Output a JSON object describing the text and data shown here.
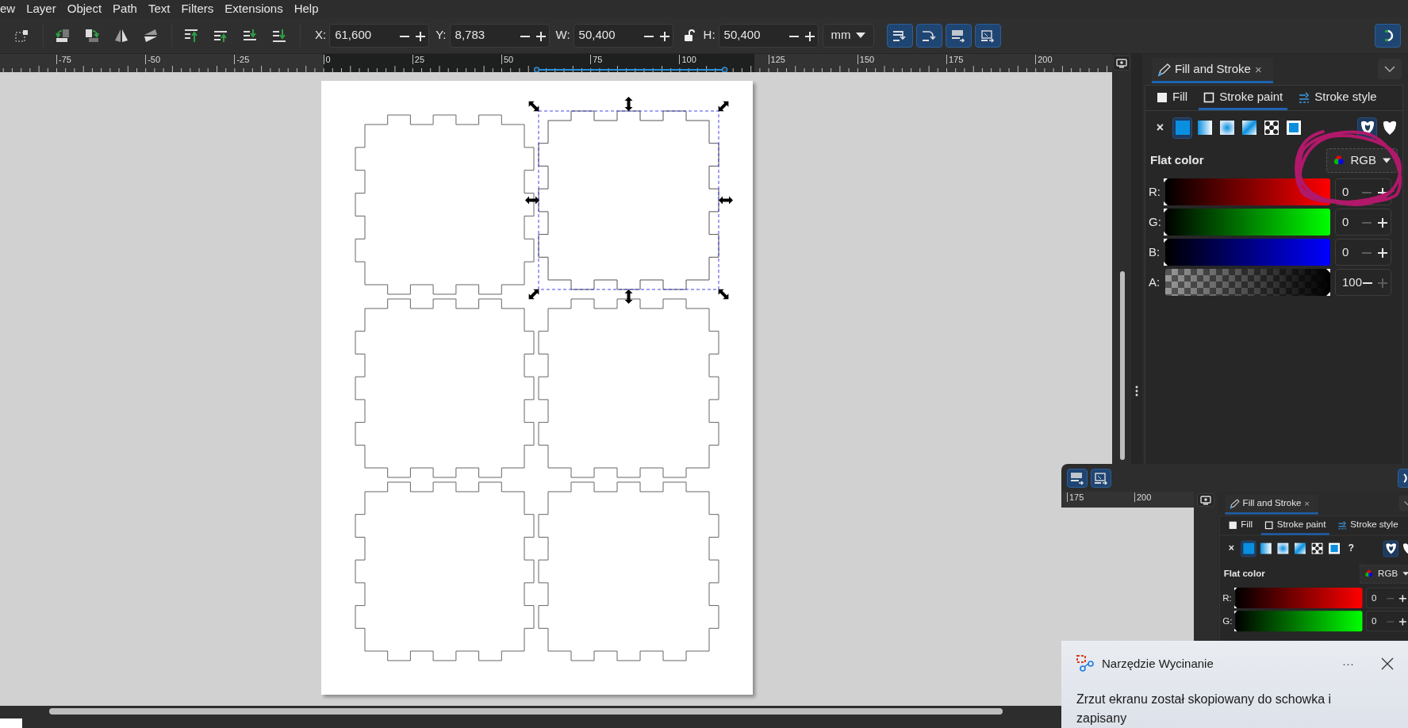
{
  "menu": [
    "ew",
    "Layer",
    "Object",
    "Path",
    "Text",
    "Filters",
    "Extensions",
    "Help"
  ],
  "toolbar": {
    "fields": [
      {
        "label": "X:",
        "value": "61,600"
      },
      {
        "label": "Y:",
        "value": "8,783"
      },
      {
        "label": "W:",
        "value": "50,400"
      },
      {
        "label": "H:",
        "value": "50,400"
      }
    ],
    "unit": "mm"
  },
  "ruler": [
    "-75",
    "-50",
    "-25",
    "0",
    "25",
    "50",
    "75",
    "100",
    "125",
    "150",
    "175",
    "200"
  ],
  "canvas": {
    "pieces": [
      {
        "selected": false
      },
      {
        "selected": true
      },
      {
        "selected": false
      },
      {
        "selected": false
      },
      {
        "selected": false
      },
      {
        "selected": false
      }
    ]
  },
  "panel": {
    "tab": "Fill and Stroke",
    "close": "×",
    "subtabs": [
      {
        "kind": "fill",
        "label": "Fill",
        "selected": false
      },
      {
        "kind": "stroke-paint",
        "label": "Stroke paint",
        "selected": true
      },
      {
        "kind": "stroke-style",
        "label": "Stroke style",
        "selected": false
      }
    ],
    "paint_types": [
      {
        "kind": "none",
        "label": "×",
        "selected": false
      },
      {
        "kind": "flat",
        "selected": true
      },
      {
        "kind": "linear",
        "selected": false
      },
      {
        "kind": "radial",
        "selected": false
      },
      {
        "kind": "mesh",
        "selected": false
      },
      {
        "kind": "pattern",
        "selected": false
      },
      {
        "kind": "swatch",
        "selected": false
      }
    ],
    "fill_rules": [
      {
        "kind": "evenodd",
        "selected": true
      },
      {
        "kind": "nonzero",
        "selected": false
      }
    ],
    "mode": "Flat color",
    "color_model": "RGB",
    "channels": [
      {
        "label": "R:",
        "kind": "red",
        "level": 0,
        "value": "0",
        "minus_disabled": true,
        "plus_disabled": false
      },
      {
        "label": "G:",
        "kind": "green",
        "level": 0,
        "value": "0",
        "minus_disabled": true,
        "plus_disabled": false
      },
      {
        "label": "B:",
        "kind": "blue",
        "level": 0,
        "value": "0",
        "minus_disabled": true,
        "plus_disabled": false
      },
      {
        "label": "A:",
        "kind": "alpha",
        "level": 1,
        "value": "100",
        "minus_disabled": false,
        "plus_disabled": true
      }
    ]
  },
  "second_window": {
    "ruler": [
      "175",
      "200"
    ],
    "panel": {
      "tab": "Fill and Stroke",
      "close": "×",
      "subtabs": [
        {
          "kind": "fill",
          "label": "Fill",
          "selected": false
        },
        {
          "kind": "stroke-paint",
          "label": "Stroke paint",
          "selected": true
        },
        {
          "kind": "stroke-style",
          "label": "Stroke style",
          "selected": false
        }
      ],
      "paint_types": [
        {
          "kind": "none",
          "label": "×",
          "selected": false
        },
        {
          "kind": "flat",
          "selected": true
        },
        {
          "kind": "linear",
          "selected": false
        },
        {
          "kind": "radial",
          "selected": false
        },
        {
          "kind": "mesh",
          "selected": false
        },
        {
          "kind": "pattern",
          "selected": false
        },
        {
          "kind": "swatch",
          "selected": false
        },
        {
          "kind": "unset",
          "label": "?",
          "selected": false
        }
      ],
      "fill_rules": [
        {
          "kind": "evenodd",
          "selected": true
        },
        {
          "kind": "nonzero",
          "selected": false
        }
      ],
      "mode": "Flat color",
      "color_model": "RGB",
      "channels": [
        {
          "label": "R:",
          "kind": "red",
          "level": 0,
          "value": "0",
          "minus_disabled": true,
          "plus_disabled": false
        },
        {
          "label": "G:",
          "kind": "green",
          "level": 0,
          "value": "0",
          "minus_disabled": true,
          "plus_disabled": false
        }
      ]
    }
  },
  "notification": {
    "app": "Narzędzie Wycinanie",
    "more": "···",
    "message": "Zrzut ekranu został skopiowany do schowka i zapisany"
  }
}
